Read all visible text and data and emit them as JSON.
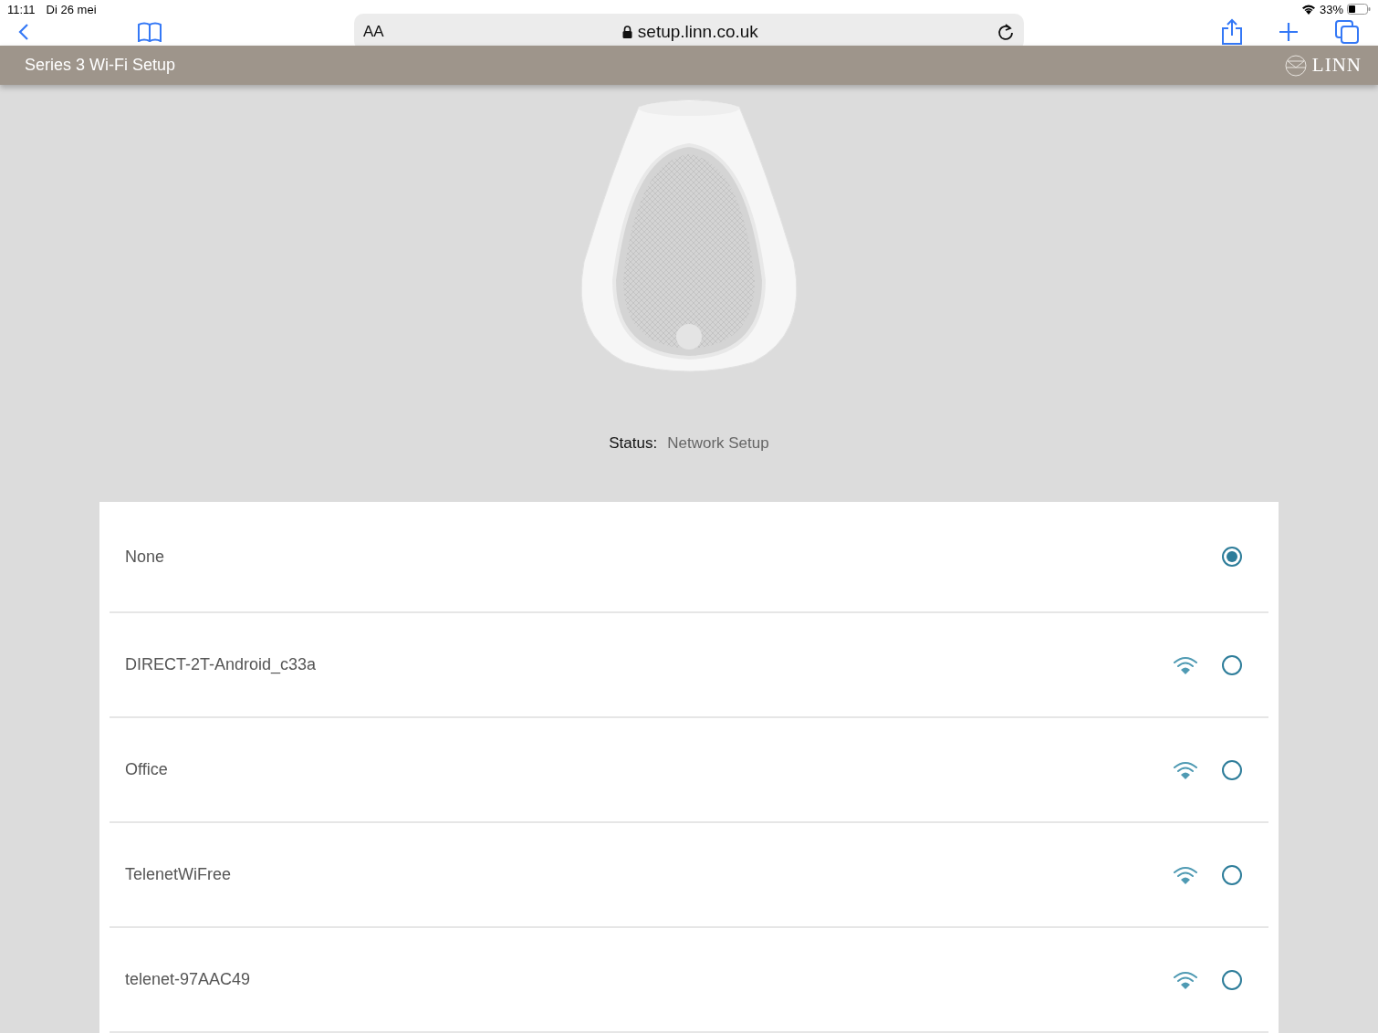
{
  "status_bar": {
    "time": "11:11",
    "date": "Di 26 mei",
    "battery": "33%"
  },
  "browser": {
    "text_size_button": "AA",
    "url": "setup.linn.co.uk"
  },
  "header": {
    "title": "Series 3 Wi-Fi Setup",
    "logo": "LINN"
  },
  "status": {
    "label": "Status:",
    "value": "Network Setup"
  },
  "networks": [
    {
      "name": "None",
      "kind": "none",
      "selected": true
    },
    {
      "name": "DIRECT-2T-Android_c33a",
      "kind": "network",
      "selected": false
    },
    {
      "name": "Office",
      "kind": "network",
      "selected": false
    },
    {
      "name": "TelenetWiFree",
      "kind": "network",
      "selected": false
    },
    {
      "name": "telenet-97AAC49",
      "kind": "network",
      "selected": false
    }
  ]
}
